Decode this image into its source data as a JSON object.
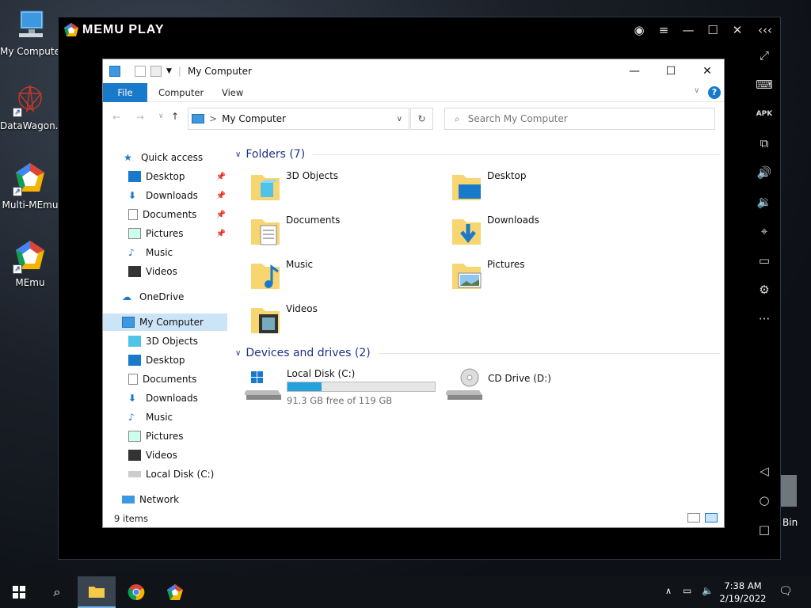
{
  "desktop": {
    "icons": [
      {
        "label": "My Compute"
      },
      {
        "label": "DataWagon..."
      },
      {
        "label": "Multi-MEmu"
      },
      {
        "label": "MEmu"
      }
    ],
    "recycle_partial": "Bin"
  },
  "emulator": {
    "title": "MEMU PLAY",
    "title_icons": [
      "account-icon",
      "menu-icon",
      "minimize-icon",
      "maximize-icon",
      "close-icon",
      "collapse-icon"
    ],
    "sidebar_icons": [
      "fullscreen-icon",
      "keyboard-icon",
      "apk-icon",
      "multi-window-icon",
      "volume-up-icon",
      "volume-down-icon",
      "location-icon",
      "folder-icon",
      "settings-icon",
      "more-icon",
      "back-icon",
      "home-icon",
      "recents-icon"
    ],
    "apk_label": "APK"
  },
  "explorer": {
    "title": "My Computer",
    "ribbon": {
      "file": "File",
      "computer": "Computer",
      "view": "View"
    },
    "address": {
      "path": "My Computer",
      "separator": ">"
    },
    "search": {
      "placeholder": "Search My Computer"
    },
    "nav": {
      "quick_access": "Quick access",
      "quick_items": [
        "Desktop",
        "Downloads",
        "Documents",
        "Pictures",
        "Music",
        "Videos"
      ],
      "onedrive": "OneDrive",
      "my_computer": "My Computer",
      "mc_items": [
        "3D Objects",
        "Desktop",
        "Documents",
        "Downloads",
        "Music",
        "Pictures",
        "Videos",
        "Local Disk (C:)"
      ],
      "network": "Network"
    },
    "folders_header": "Folders (7)",
    "folders": [
      "3D Objects",
      "Desktop",
      "Documents",
      "Downloads",
      "Music",
      "Pictures",
      "Videos"
    ],
    "devices_header": "Devices and drives (2)",
    "drives": [
      {
        "name": "Local Disk (C:)",
        "free": "91.3 GB free of 119 GB",
        "used_fraction": 0.233
      },
      {
        "name": "CD Drive (D:)"
      }
    ],
    "status": "9 items",
    "accent": "#1979ca"
  },
  "taskbar": {
    "time": "7:38 AM",
    "date": "2/19/2022"
  }
}
